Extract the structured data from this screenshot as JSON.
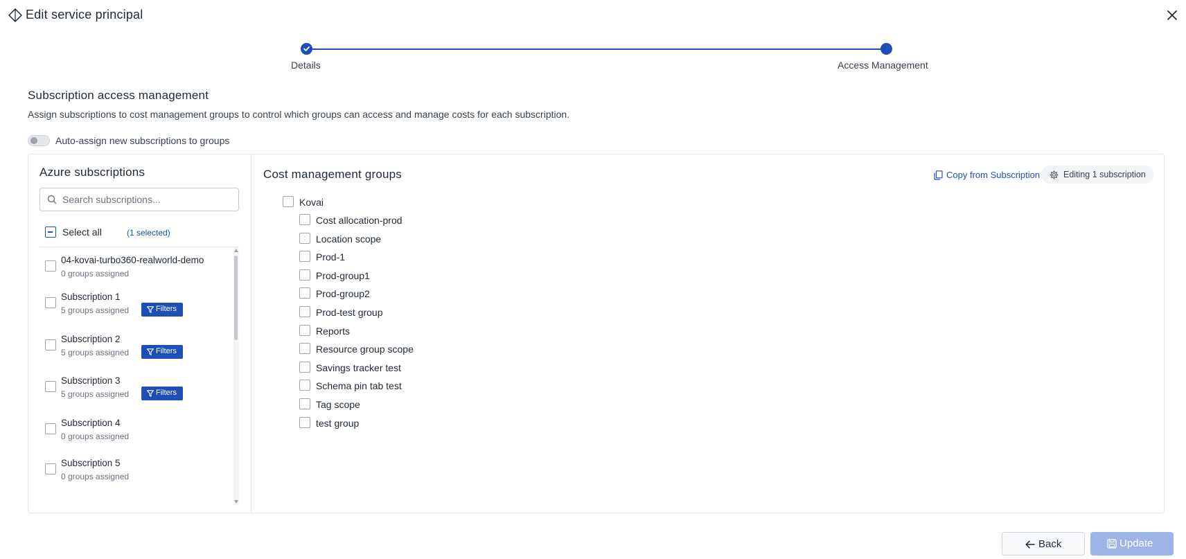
{
  "header": {
    "title": "Edit service principal",
    "icon": "diamond-icon",
    "close_icon": "close-icon"
  },
  "stepper": {
    "steps": [
      {
        "label": "Details",
        "state": "completed"
      },
      {
        "label": "Access Management",
        "state": "current"
      }
    ]
  },
  "section": {
    "title": "Subscription access management",
    "description": "Assign subscriptions to cost management groups to control which groups can access and manage costs for each subscription."
  },
  "auto_assign": {
    "label": "Auto-assign new subscriptions to groups",
    "enabled": false
  },
  "subscriptions": {
    "title": "Azure subscriptions",
    "search_placeholder": "Search subscriptions...",
    "select_all_label": "Select all",
    "selected_count": "(1 selected)",
    "filters_label": "Filters",
    "items": [
      {
        "name": "04-kovai-turbo360-realworld-demo",
        "groups": "0 groups assigned",
        "has_filters": false
      },
      {
        "name": "Subscription 1",
        "groups": "5 groups assigned",
        "has_filters": true
      },
      {
        "name": "Subscription 2",
        "groups": "5 groups assigned",
        "has_filters": true
      },
      {
        "name": "Subscription 3",
        "groups": "5 groups assigned",
        "has_filters": true
      },
      {
        "name": "Subscription 4",
        "groups": "0 groups assigned",
        "has_filters": false
      },
      {
        "name": "Subscription 5",
        "groups": "0 groups assigned",
        "has_filters": false
      }
    ]
  },
  "cost_groups": {
    "title": "Cost management groups",
    "copy_label": "Copy from Subscription",
    "editing_label": "Editing 1 subscription",
    "root": "Kovai",
    "children": [
      "Cost allocation-prod",
      "Location scope",
      "Prod-1",
      "Prod-group1",
      "Prod-group2",
      "Prod-test group",
      "Reports",
      "Resource group scope",
      "Savings tracker test",
      "Schema pin tab test",
      "Tag scope",
      "test group"
    ]
  },
  "footer": {
    "back_label": "Back",
    "update_label": "Update"
  },
  "colors": {
    "accent": "#1e4fb6",
    "update_disabled": "#9db5e6"
  }
}
